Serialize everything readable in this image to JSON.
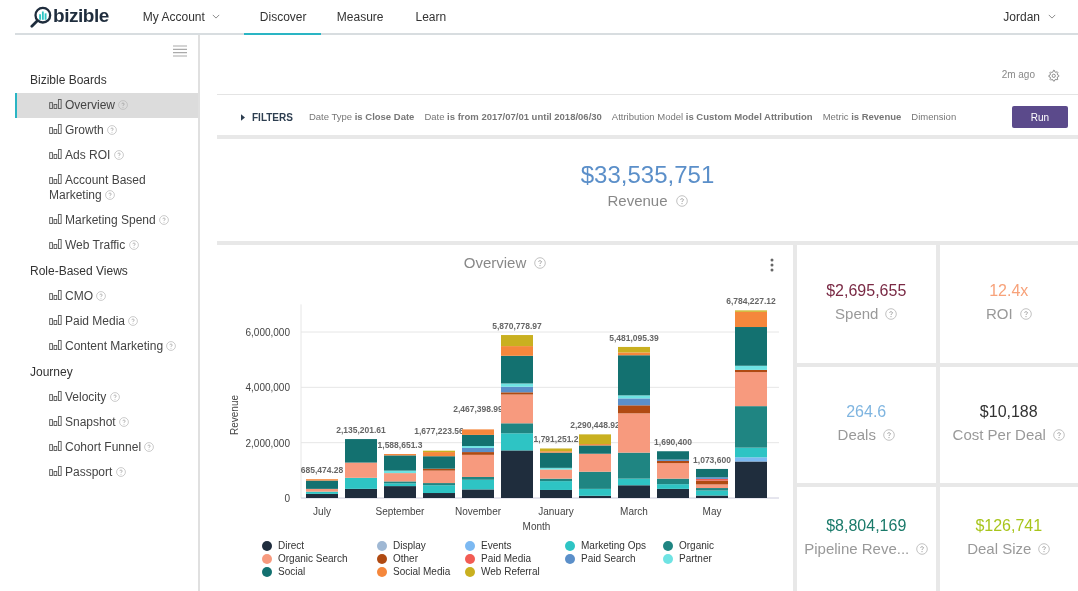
{
  "header": {
    "logo": "bizible",
    "account_menu": {
      "label": "My Account"
    },
    "tabs": [
      {
        "label": "Discover",
        "selected": true
      },
      {
        "label": "Measure",
        "selected": false
      },
      {
        "label": "Learn",
        "selected": false
      }
    ],
    "user_menu": {
      "label": "Jordan"
    }
  },
  "sidebar": {
    "sections": [
      {
        "title": "Bizible Boards",
        "items": [
          {
            "label": "Overview",
            "selected": true
          },
          {
            "label": "Growth",
            "selected": false
          },
          {
            "label": "Ads ROI",
            "selected": false
          },
          {
            "label": "Account Based Marketing",
            "selected": false
          },
          {
            "label": "Marketing Spend",
            "selected": false
          },
          {
            "label": "Web Traffic",
            "selected": false
          }
        ]
      },
      {
        "title": "Role-Based Views",
        "items": [
          {
            "label": "CMO",
            "selected": false
          },
          {
            "label": "Paid Media",
            "selected": false
          },
          {
            "label": "Content Marketing",
            "selected": false
          }
        ]
      },
      {
        "title": "Journey",
        "items": [
          {
            "label": "Velocity",
            "selected": false
          },
          {
            "label": "Snapshot",
            "selected": false
          },
          {
            "label": "Cohort Funnel",
            "selected": false
          },
          {
            "label": "Passport",
            "selected": false
          }
        ]
      }
    ]
  },
  "updated": "2m ago",
  "filters": {
    "label": "FILTERS",
    "items": [
      "Date Type **is Close Date**",
      "Date **is from 2017/07/01 until 2018/06/30**",
      "Attribution Model **is Custom Model Attribution**",
      "Metric **is Revenue**",
      "Dimension"
    ],
    "run_button": "Run"
  },
  "headline": {
    "value": "$33,535,751",
    "label": "Revenue"
  },
  "overview": {
    "title": "Overview",
    "chart_data": {
      "type": "bar",
      "stacked": true,
      "xlabel": "Month",
      "ylabel": "Revenue",
      "categories": [
        "July",
        null,
        "September",
        null,
        "November",
        null,
        "January",
        null,
        "March",
        null,
        "May",
        null
      ],
      "grid": true,
      "legend": true,
      "ylim": [
        0,
        7000000
      ],
      "yticks": [
        {
          "value": 0,
          "label": "0"
        },
        {
          "value": 2000000,
          "label": "2,000,000"
        },
        {
          "value": 4000000,
          "label": "4,000,000"
        },
        {
          "value": 6000000,
          "label": "6,000,000"
        }
      ],
      "value_labels": [
        "685,474.28",
        "2,135,201.61",
        "1,588,651.3",
        "1,677,223.56",
        "2,467,398.99",
        "5,870,778.97",
        "1,791,251.2",
        "2,290,448.92",
        "5,481,095.39",
        "1,690,400",
        "1,073,600",
        "6,784,227.12"
      ],
      "series": [
        {
          "name": "Direct",
          "color": "#1f2d3d",
          "values": [
            150000,
            330000,
            430000,
            180000,
            310000,
            1720000,
            290000,
            80000,
            460000,
            330000,
            90000,
            1320000
          ]
        },
        {
          "name": "Display",
          "color": "#9fb8d4",
          "values": [
            0,
            0,
            0,
            0,
            0,
            0,
            0,
            0,
            0,
            0,
            0,
            0
          ]
        },
        {
          "name": "Events",
          "color": "#7cb9f2",
          "values": [
            0,
            0,
            0,
            0,
            0,
            0,
            0,
            0,
            0,
            0,
            0,
            150000
          ]
        },
        {
          "name": "Marketing Ops",
          "color": "#2ec4c4",
          "values": [
            80000,
            400000,
            100000,
            280000,
            350000,
            620000,
            320000,
            250000,
            240000,
            170000,
            180000,
            350000
          ]
        },
        {
          "name": "Organic",
          "color": "#1f8582",
          "values": [
            0,
            0,
            70000,
            80000,
            100000,
            360000,
            90000,
            620000,
            940000,
            200000,
            90000,
            1500000
          ]
        },
        {
          "name": "Organic Search",
          "color": "#f79a7e",
          "values": [
            100000,
            550000,
            300000,
            450000,
            800000,
            1040000,
            330000,
            650000,
            1420000,
            560000,
            130000,
            1230000
          ]
        },
        {
          "name": "Other",
          "color": "#b04a12",
          "values": [
            0,
            0,
            0,
            70000,
            100000,
            80000,
            0,
            0,
            290000,
            80000,
            140000,
            80000
          ]
        },
        {
          "name": "Paid Media",
          "color": "#f25c54",
          "values": [
            0,
            0,
            0,
            0,
            0,
            0,
            0,
            0,
            0,
            0,
            60000,
            0
          ]
        },
        {
          "name": "Paid Search",
          "color": "#5b8fc9",
          "values": [
            0,
            0,
            0,
            0,
            150000,
            200000,
            0,
            0,
            250000,
            50000,
            60000,
            0
          ]
        },
        {
          "name": "Partner",
          "color": "#6fe3e3",
          "values": [
            0,
            0,
            90000,
            0,
            70000,
            120000,
            60000,
            0,
            110000,
            0,
            0,
            150000
          ]
        },
        {
          "name": "Social",
          "color": "#137170",
          "values": [
            300000,
            850000,
            550000,
            450000,
            400000,
            1000000,
            550000,
            300000,
            1450000,
            300000,
            300000,
            1400000
          ]
        },
        {
          "name": "Social Media",
          "color": "#f5873c",
          "values": [
            50000,
            0,
            50000,
            150000,
            200000,
            350000,
            50000,
            50000,
            100000,
            0,
            0,
            550000
          ]
        },
        {
          "name": "Web Referral",
          "color": "#c9b020",
          "values": [
            0,
            0,
            0,
            50000,
            0,
            400000,
            100000,
            350000,
            200000,
            0,
            0,
            50000
          ]
        }
      ]
    }
  },
  "kpis": [
    {
      "value": "$2,695,655",
      "label": "Spend",
      "color": "#7a2a45"
    },
    {
      "value": "12.4x",
      "label": "ROI",
      "color": "#f7a27a"
    },
    {
      "value": "264.6",
      "label": "Deals",
      "color": "#7fb5e0"
    },
    {
      "value": "$10,188",
      "label": "Cost Per Deal",
      "color": "#333333"
    },
    {
      "value": "$8,804,169",
      "label": "Pipeline Reve...",
      "color": "#1a7a6a"
    },
    {
      "value": "$126,741",
      "label": "Deal Size",
      "color": "#a8c51c"
    }
  ]
}
